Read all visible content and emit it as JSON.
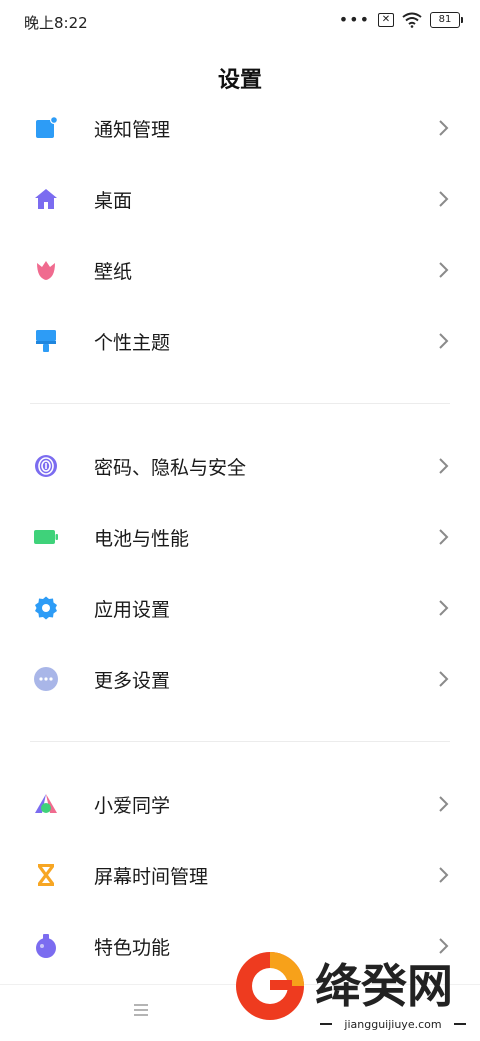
{
  "status_bar": {
    "time": "晚上8:22",
    "more": "•••",
    "battery": "81"
  },
  "page_title": "设置",
  "group1": [
    {
      "label": "通知管理",
      "icon": "notification-icon"
    },
    {
      "label": "桌面",
      "icon": "home-icon"
    },
    {
      "label": "壁纸",
      "icon": "tulip-icon"
    },
    {
      "label": "个性主题",
      "icon": "brush-icon"
    }
  ],
  "group2": [
    {
      "label": "密码、隐私与安全",
      "icon": "fingerprint-icon"
    },
    {
      "label": "电池与性能",
      "icon": "battery-icon"
    },
    {
      "label": "应用设置",
      "icon": "gear-icon"
    },
    {
      "label": "更多设置",
      "icon": "more-icon"
    }
  ],
  "group3": [
    {
      "label": "小爱同学",
      "icon": "xiaoai-icon"
    },
    {
      "label": "屏幕时间管理",
      "icon": "hourglass-icon"
    },
    {
      "label": "特色功能",
      "icon": "flask-icon"
    }
  ],
  "watermark": {
    "name": "绛癸网",
    "url": "jiangguijiuye.com"
  },
  "colors": {
    "blue": "#2d9cf6",
    "purple": "#7b6cf0",
    "pink": "#f06b8f",
    "green": "#3fd27a",
    "gray_blue": "#a9b6e8",
    "orange": "#f7a623"
  }
}
